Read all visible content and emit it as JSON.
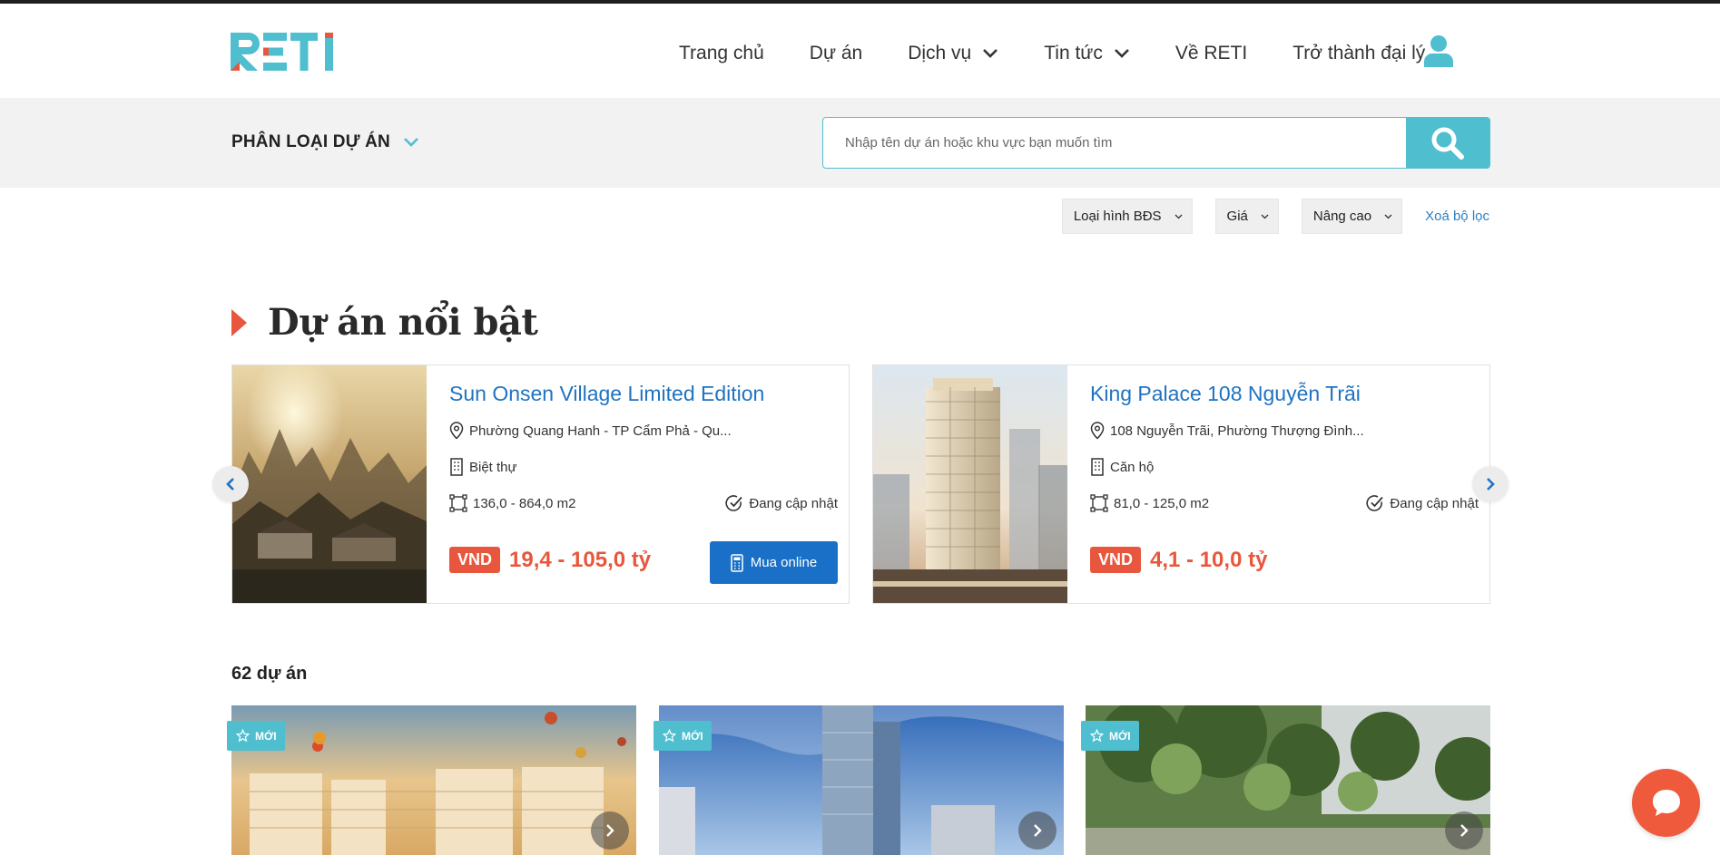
{
  "brand": {
    "logo_text": "RETI",
    "colors": {
      "teal": "#4fbecf",
      "orange": "#e8573d",
      "blue": "#1a70c6",
      "link": "#1f73c2"
    }
  },
  "nav": {
    "items": [
      {
        "label": "Trang chủ"
      },
      {
        "label": "Dự án"
      },
      {
        "label": "Dịch vụ",
        "has_dropdown": true
      },
      {
        "label": "Tin tức",
        "has_dropdown": true
      },
      {
        "label": "Về RETI"
      },
      {
        "label": "Trở thành đại lý"
      }
    ],
    "user_icon": "user-icon"
  },
  "search": {
    "category_label": "PHÂN LOẠI DỰ ÁN",
    "placeholder": "Nhập tên dự án hoặc khu vực bạn muốn tìm",
    "button_icon": "search-icon"
  },
  "filters": {
    "items": [
      {
        "label": "Loại hình BĐS"
      },
      {
        "label": "Giá"
      },
      {
        "label": "Nâng cao"
      }
    ],
    "clear_label": "Xoá bộ lọc"
  },
  "featured": {
    "title": "Dự án nổi bật",
    "cards": [
      {
        "title": "Sun Onsen Village Limited Edition",
        "address": "Phường Quang Hanh - TP Cẩm Phả - Qu...",
        "type": "Biệt thự",
        "area": "136,0 - 864,0 m2",
        "status": "Đang cập nhật",
        "currency": "VND",
        "price": "19,4 - 105,0 tỷ",
        "buy_label": "Mua online"
      },
      {
        "title": "King Palace 108 Nguyễn Trãi",
        "address": "108 Nguyễn Trãi, Phường Thượng Đình...",
        "type": "Căn hộ",
        "area": "81,0 - 125,0 m2",
        "status": "Đang cập nhật",
        "currency": "VND",
        "price": "4,1 - 10,0 tỷ"
      }
    ]
  },
  "listing": {
    "count_label": "62 dự án",
    "cards": [
      {
        "badge": "MỚI"
      },
      {
        "badge": "MỚI"
      },
      {
        "badge": "MỚI"
      }
    ]
  },
  "chat": {
    "icon": "chat-icon"
  }
}
